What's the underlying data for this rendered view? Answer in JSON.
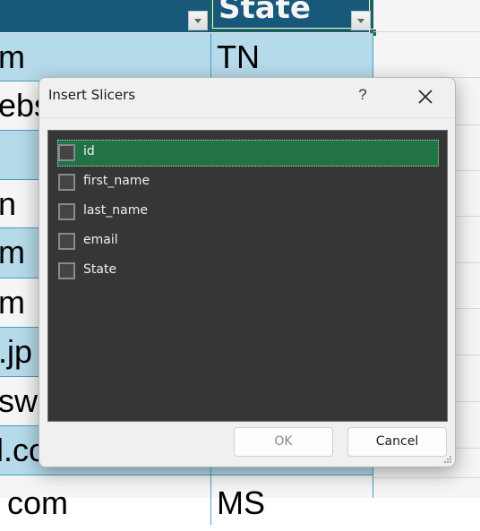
{
  "sheet": {
    "header": {
      "state_label": "State"
    },
    "rows": [
      {
        "col1": "m",
        "state": "TN"
      },
      {
        "col1": "ebs",
        "state": ""
      },
      {
        "col1": "",
        "state": ""
      },
      {
        "col1": "n",
        "state": ""
      },
      {
        "col1": "m",
        "state": ""
      },
      {
        "col1": "m",
        "state": ""
      },
      {
        "col1": ".jp",
        "state": ""
      },
      {
        "col1": "sw",
        "state": ""
      },
      {
        "col1": "l.co",
        "state": ""
      },
      {
        "col1": "com",
        "state": "MS"
      }
    ]
  },
  "dialog": {
    "title": "Insert Slicers",
    "help_label": "?",
    "close_icon": "close-icon",
    "fields": [
      {
        "label": "id",
        "checked": false,
        "selected": true
      },
      {
        "label": "first_name",
        "checked": false,
        "selected": false
      },
      {
        "label": "last_name",
        "checked": false,
        "selected": false
      },
      {
        "label": "email",
        "checked": false,
        "selected": false
      },
      {
        "label": "State",
        "checked": false,
        "selected": false
      }
    ],
    "ok_label": "OK",
    "ok_enabled": false,
    "cancel_label": "Cancel"
  },
  "colors": {
    "header_bg": "#185c80",
    "row_band": "#bde3f3",
    "selection_green": "#217346"
  }
}
